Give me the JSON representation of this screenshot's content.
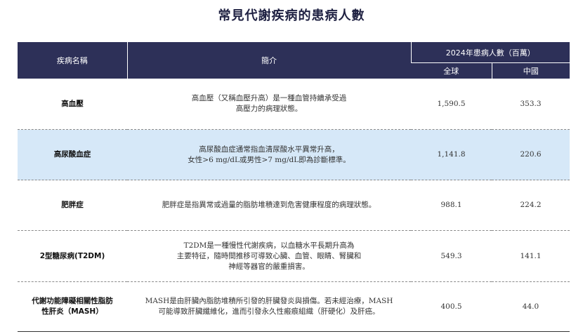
{
  "title": "常見代謝疾病的患病人數",
  "headers": {
    "disease": "疾病名稱",
    "intro": "簡介",
    "count_group": "2024年患病人數（百萬）",
    "global": "全球",
    "china": "中國"
  },
  "rows": [
    {
      "name": [
        "高血壓"
      ],
      "desc": [
        "高血壓（又稱血壓升高）是一種血管持續承受過",
        "高壓力的病理狀態。"
      ],
      "global": "1,590.5",
      "china": "353.3"
    },
    {
      "name": [
        "高尿酸血症"
      ],
      "desc": [
        "高尿酸血症通常指血清尿酸水平異常升高，",
        "女性>6 mg/dL或男性>7 mg/dL即為診斷標準。"
      ],
      "global": "1,141.8",
      "china": "220.6"
    },
    {
      "name": [
        "肥胖症"
      ],
      "desc": [
        "肥胖症是指異常或過量的脂肪堆積達到危害健康程度的病理狀態。"
      ],
      "global": "988.1",
      "china": "224.2"
    },
    {
      "name": [
        "2型糖尿病(T2DM)"
      ],
      "desc": [
        "T2DM是一種慢性代謝疾病，以血糖水平長期升高為",
        "主要特征，隨時間推移可導致心臟、血管、眼睛、腎臟和",
        "神經等器官的嚴重損害。"
      ],
      "global": "549.3",
      "china": "141.1"
    },
    {
      "name": [
        "代謝功能障礙相關性脂肪",
        "性肝炎（MASH）"
      ],
      "desc": [
        "MASH是由肝臟內脂肪堆積所引發的肝臟發炎與損傷。若未經治療，MASH",
        "可能導致肝臟纖維化，進而引發永久性瘢痕組織（肝硬化）及肝癌。"
      ],
      "global": "400.5",
      "china": "44.0"
    }
  ]
}
